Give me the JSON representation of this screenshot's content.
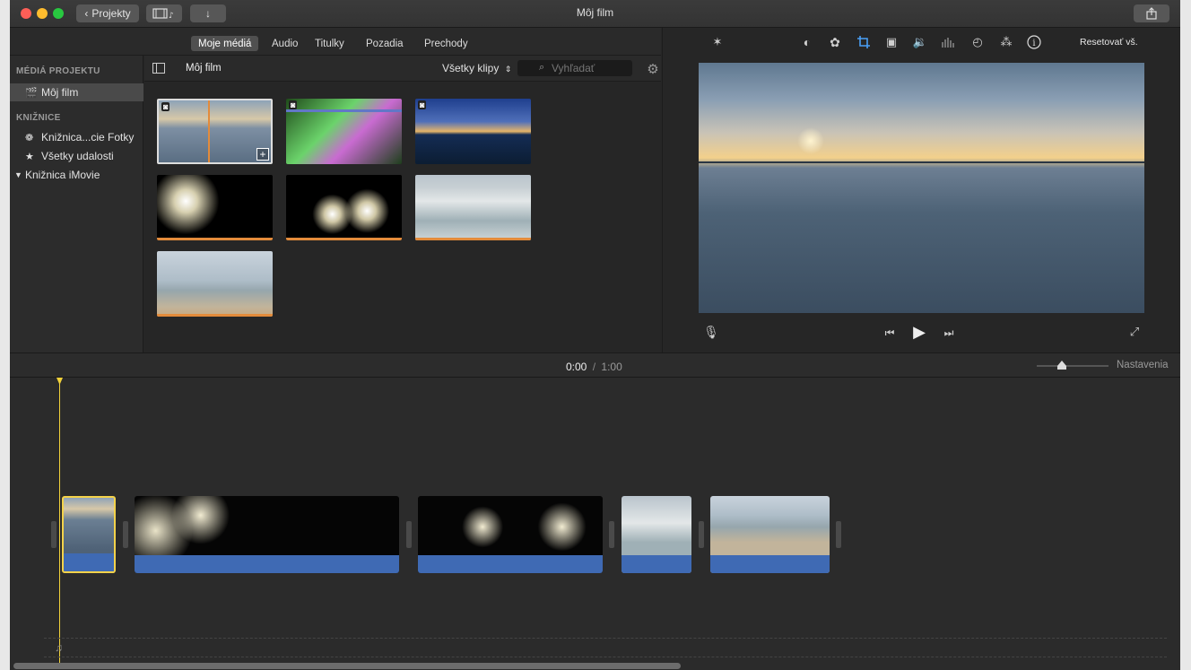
{
  "window": {
    "title": "Môj film"
  },
  "titlebar": {
    "back_label": "Projekty"
  },
  "tabs": [
    {
      "label": "Moje médiá",
      "active": true
    },
    {
      "label": "Audio"
    },
    {
      "label": "Titulky"
    },
    {
      "label": "Pozadia"
    },
    {
      "label": "Prechody"
    }
  ],
  "sidebar": {
    "project_header": "MÉDIÁ PROJEKTU",
    "project_item": "Môj film",
    "libraries_header": "KNIŽNICE",
    "items": [
      {
        "label": "Knižnica...cie Fotky",
        "icon": "photos-icon"
      },
      {
        "label": "Všetky udalosti",
        "icon": "star-icon"
      },
      {
        "label": "Knižnica iMovie",
        "icon": "disclosure-triangle-icon"
      }
    ]
  },
  "browser": {
    "title": "Môj film",
    "filter": "Všetky klipy",
    "search_placeholder": "Vyhľadať"
  },
  "viewer": {
    "reset_label": "Resetovať vš."
  },
  "timeline": {
    "current_time": "0:00",
    "separator": "/",
    "total_time": "1:00",
    "settings_label": "Nastavenia"
  },
  "colors": {
    "accent": "#e38b3b",
    "selection": "#f3d24a",
    "audio": "#3f6ab4",
    "playhead": "#f2d23a"
  }
}
